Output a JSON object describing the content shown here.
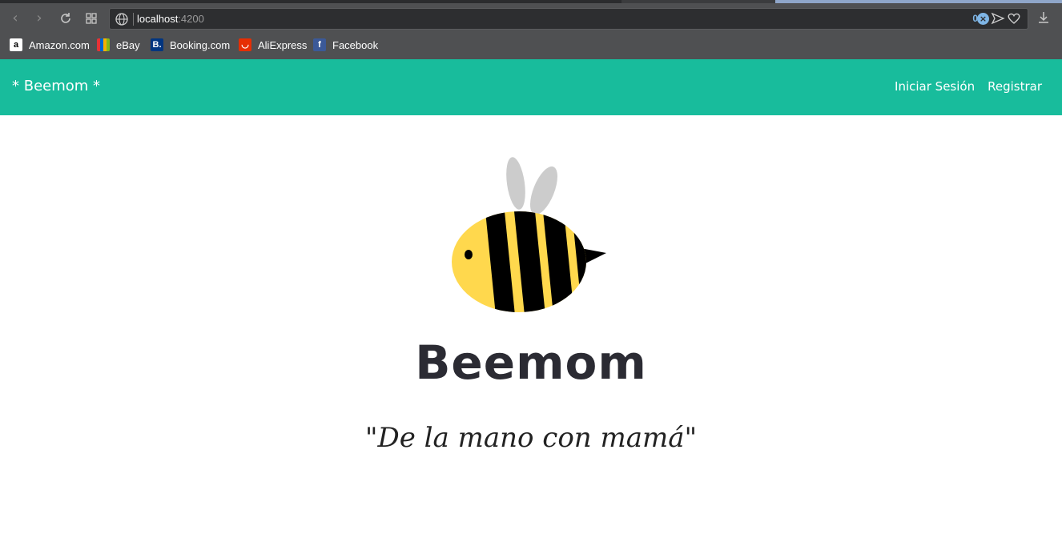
{
  "browser": {
    "url_host": "localhost",
    "url_port": ":4200",
    "blocked_count": "0",
    "bookmarks": [
      {
        "label": "Amazon.com",
        "icon": "amazon-icon"
      },
      {
        "label": "eBay",
        "icon": "ebay-icon"
      },
      {
        "label": "Booking.com",
        "icon": "booking-icon"
      },
      {
        "label": "AliExpress",
        "icon": "aliexpress-icon"
      },
      {
        "label": "Facebook",
        "icon": "facebook-icon"
      }
    ]
  },
  "navbar": {
    "brand": "* Beemom *",
    "links": [
      "Iniciar Sesión",
      "Registrar"
    ],
    "color": "#18bc9c"
  },
  "hero": {
    "title": "Beemom",
    "slogan": "\"De la mano con mamá\"",
    "logo_icon": "bee-icon"
  },
  "colors": {
    "bee_yellow": "#ffd84d",
    "bee_stripe": "#000000",
    "wing": "#cccccc"
  }
}
